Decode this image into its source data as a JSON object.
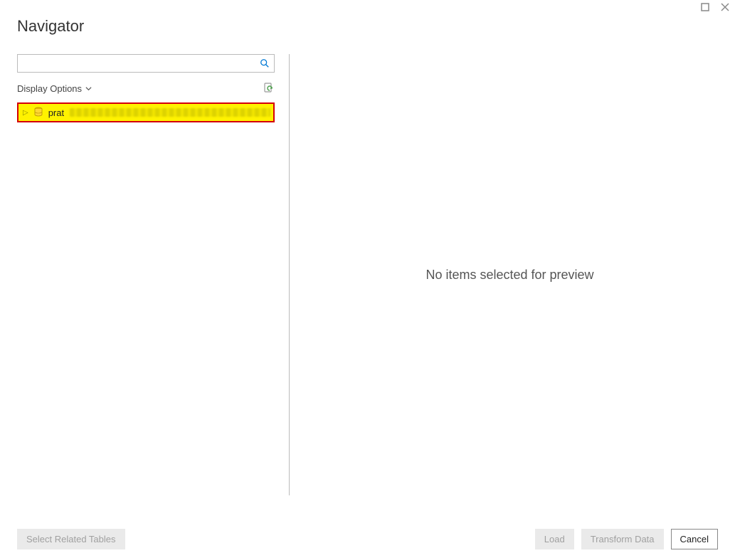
{
  "window": {
    "title": "Navigator"
  },
  "search": {
    "placeholder": ""
  },
  "options": {
    "display_options_label": "Display Options"
  },
  "tree": {
    "items": [
      {
        "label_prefix": "prat",
        "obscured": true
      }
    ]
  },
  "preview": {
    "empty_message": "No items selected for preview"
  },
  "footer": {
    "select_related_label": "Select Related Tables",
    "load_label": "Load",
    "transform_label": "Transform Data",
    "cancel_label": "Cancel"
  }
}
